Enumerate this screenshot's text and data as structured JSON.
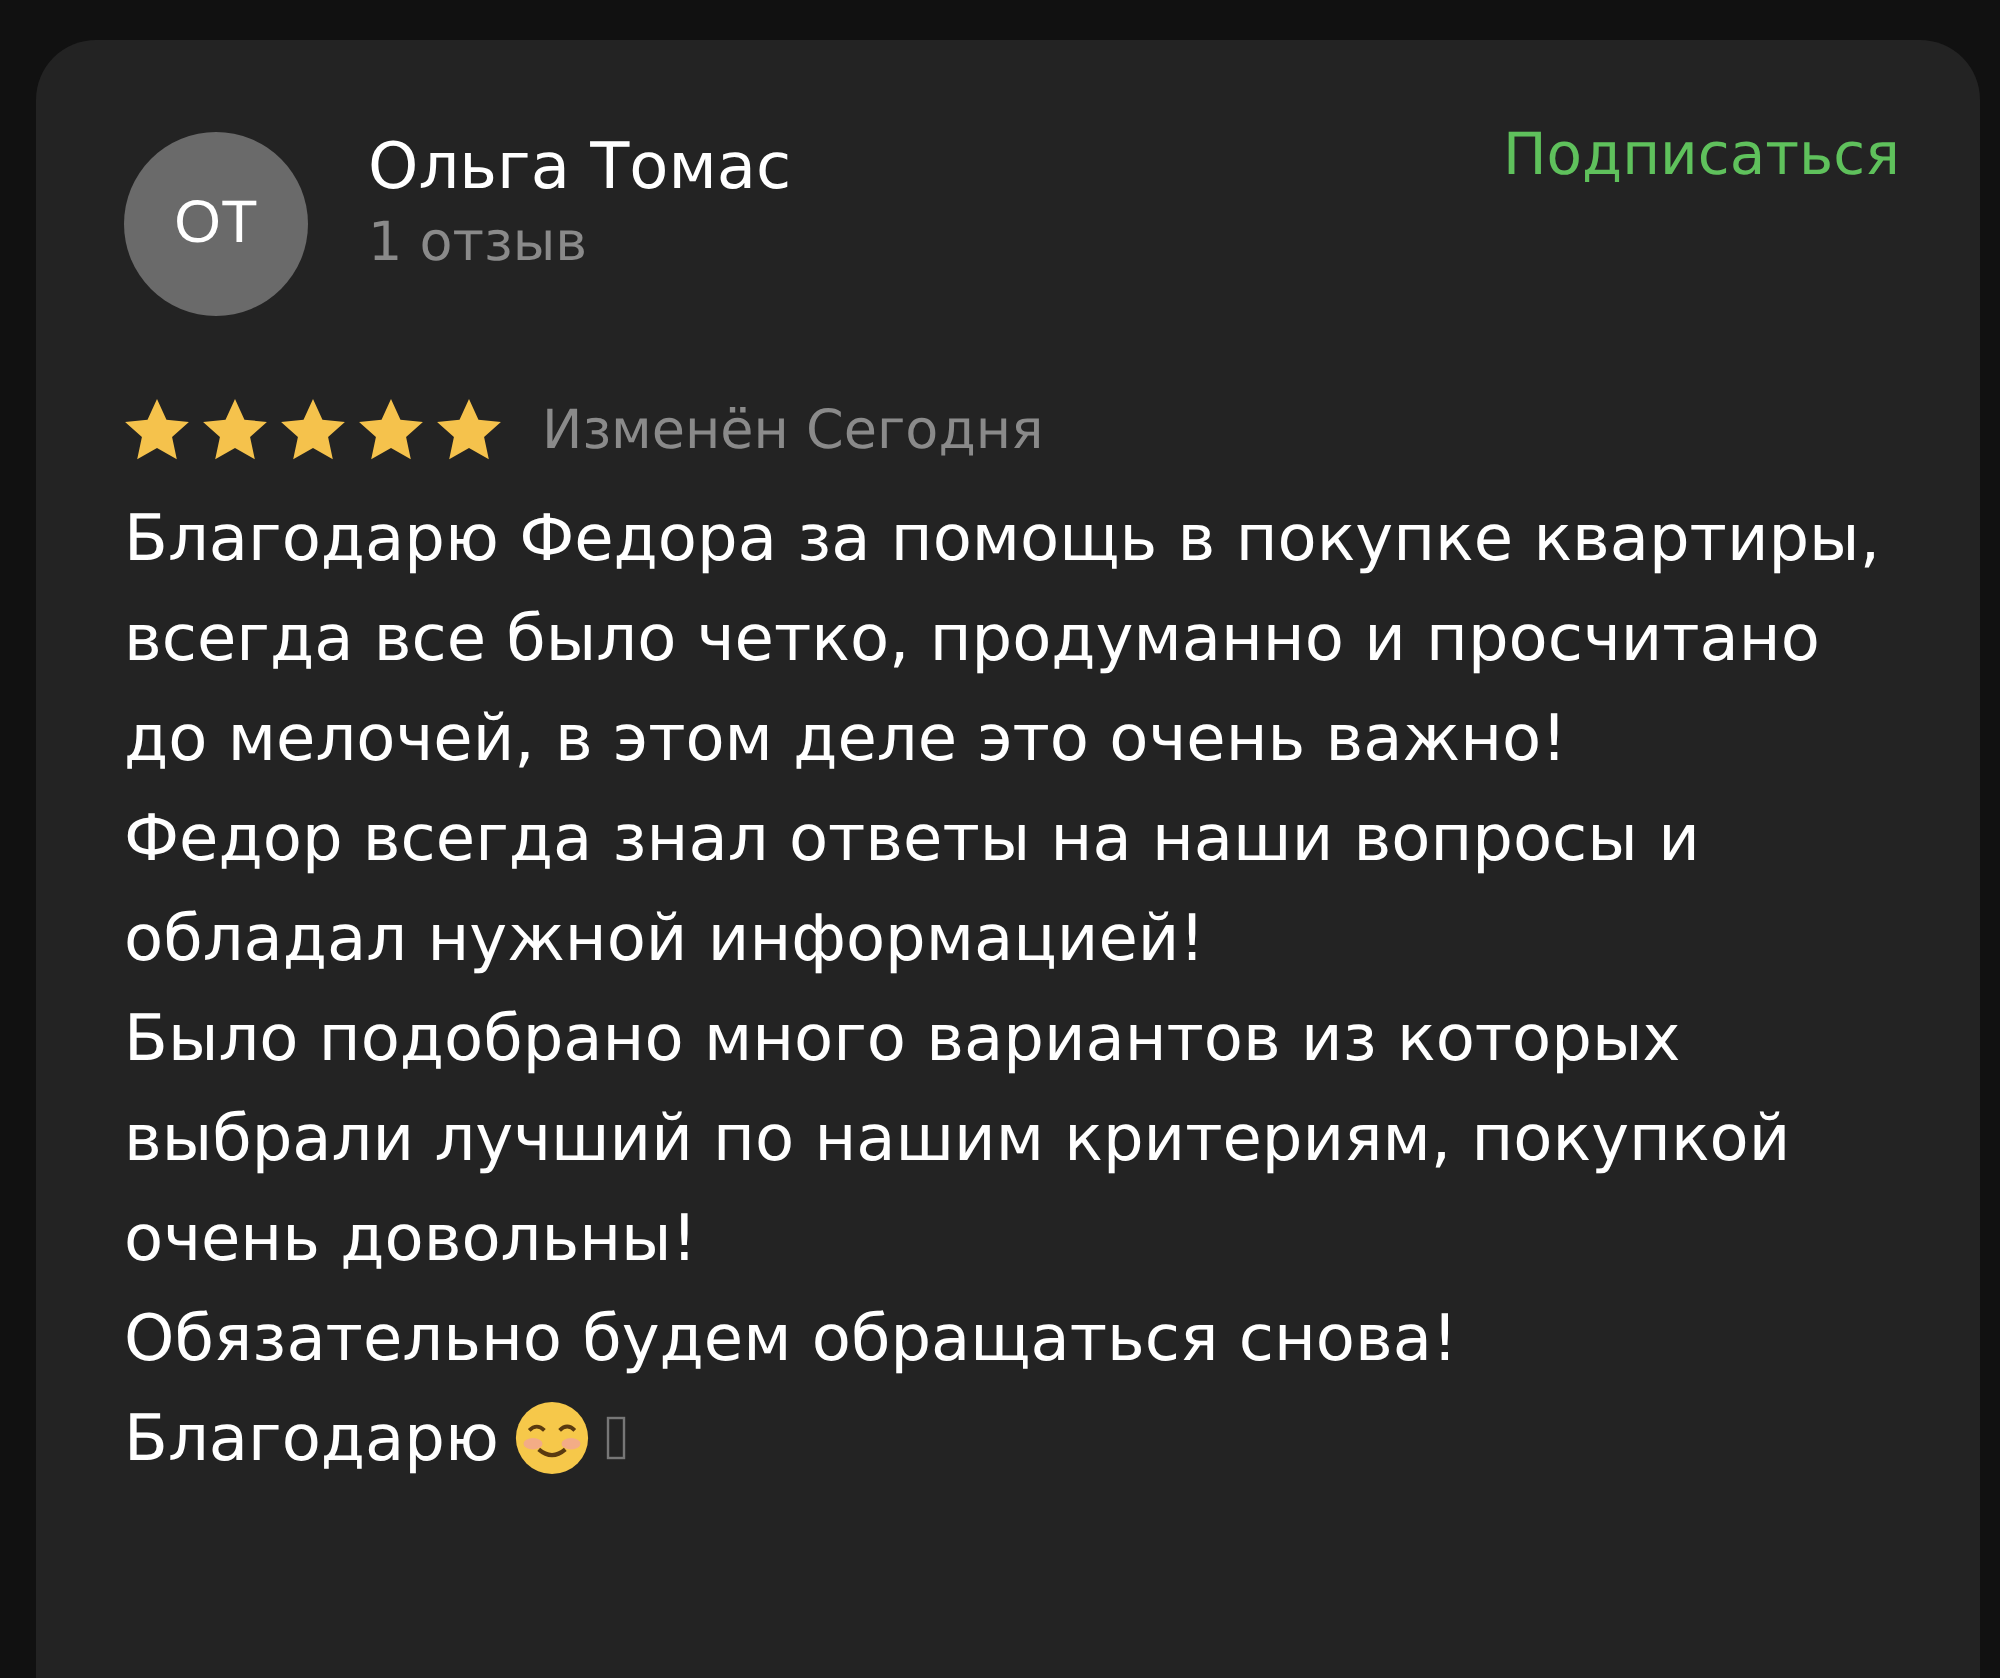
{
  "review": {
    "author": {
      "initials": "ОТ",
      "name": "Ольга Томас",
      "review_count": "1 отзыв"
    },
    "subscribe": "Подписаться",
    "stars": 5,
    "date": "Изменён Сегодня",
    "paragraphs": [
      "Благодарю Федора за помощь в покупке квартиры, всегда все было четко, продуманно и просчитано до мелочей, в этом деле это очень важно!",
      "Федор всегда знал ответы на наши вопросы и обладал нужной информацией!",
      "Было подобрано много вариантов из которых выбрали лучший по нашим критериям, покупкой очень довольны!",
      "Обязательно будем обращаться снова!",
      "Благодарю"
    ]
  }
}
